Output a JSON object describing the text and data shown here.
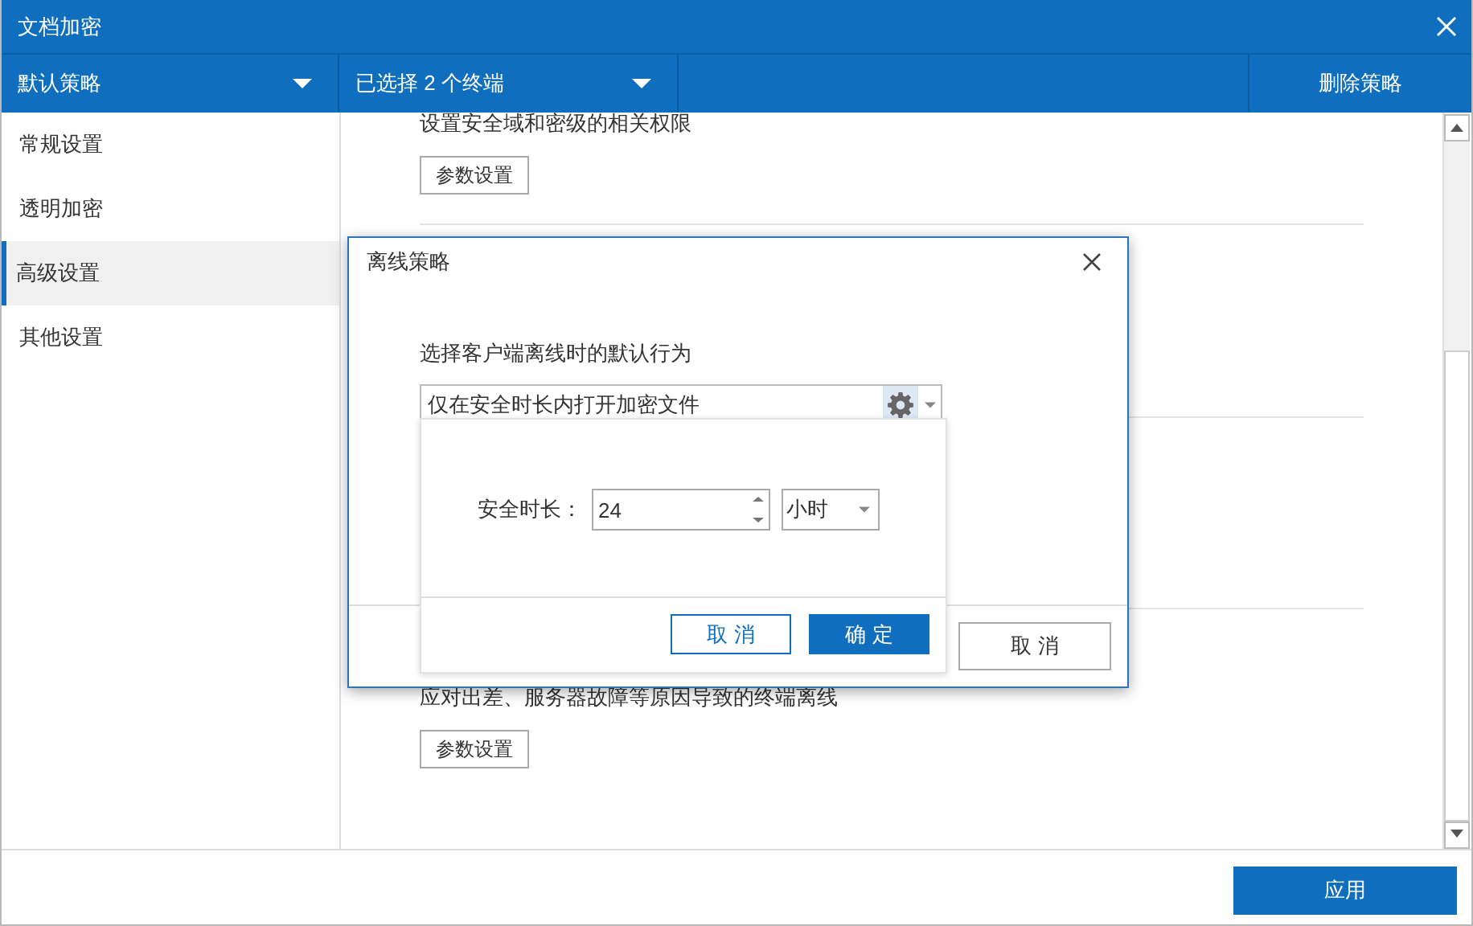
{
  "window": {
    "title": "文档加密"
  },
  "toolbar": {
    "policy_dropdown": "默认策略",
    "terminals_dropdown": "已选择 2 个终端",
    "delete_button": "删除策略"
  },
  "sidebar": {
    "items": [
      {
        "label": "常规设置",
        "selected": false
      },
      {
        "label": "透明加密",
        "selected": false
      },
      {
        "label": "高级设置",
        "selected": true
      },
      {
        "label": "其他设置",
        "selected": false
      }
    ]
  },
  "sections": [
    {
      "description": "设置安全域和密级的相关权限",
      "button": "参数设置"
    },
    {
      "description": "应对出差、服务器故障等原因导致的终端离线",
      "button": "参数设置"
    }
  ],
  "dialog": {
    "title": "离线策略",
    "prompt": "选择客户端离线时的默认行为",
    "behavior_select": "仅在安全时长内打开加密文件",
    "cancel_button": "取 消",
    "popup": {
      "duration_label": "安全时长：",
      "duration_value": "24",
      "unit_select": "小时",
      "cancel_button": "取 消",
      "confirm_button": "确 定"
    }
  },
  "footer": {
    "apply_button": "应用"
  }
}
